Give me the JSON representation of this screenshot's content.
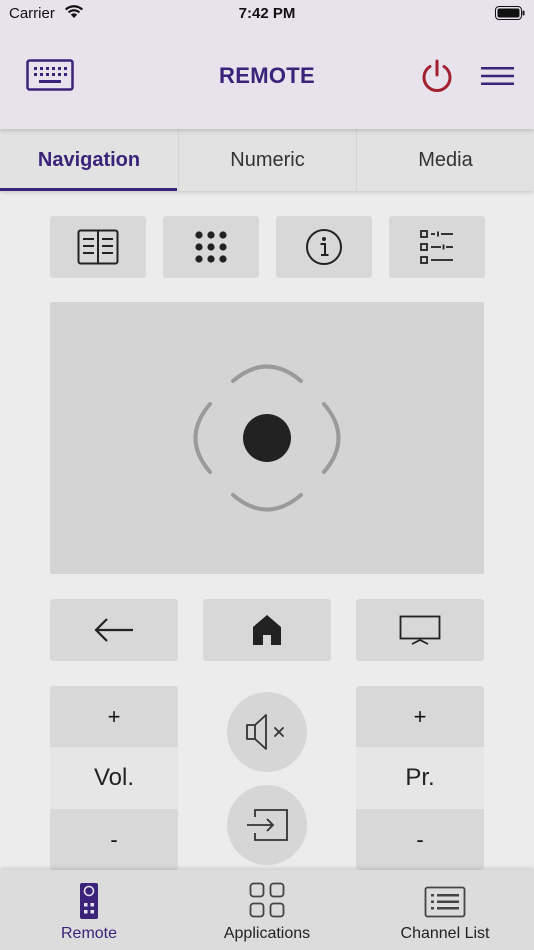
{
  "status_bar": {
    "carrier": "Carrier",
    "time": "7:42 PM"
  },
  "header": {
    "title": "REMOTE",
    "keyboard_icon": "keyboard-icon",
    "power_icon": "power-icon",
    "menu_icon": "hamburger-menu-icon"
  },
  "tabs": [
    {
      "label": "Navigation",
      "active": true
    },
    {
      "label": "Numeric",
      "active": false
    },
    {
      "label": "Media",
      "active": false
    }
  ],
  "function_buttons": [
    "guide-icon",
    "numpad-icon",
    "info-icon",
    "list-icon"
  ],
  "nav_buttons": [
    "back-arrow-icon",
    "home-icon",
    "tv-icon"
  ],
  "volume": {
    "plus": "+",
    "label": "Vol.",
    "minus": "-"
  },
  "program": {
    "plus": "+",
    "label": "Pr.",
    "minus": "-"
  },
  "center_buttons": [
    "mute-icon",
    "source-input-icon"
  ],
  "bottom_nav": [
    {
      "label": "Remote",
      "icon": "remote-icon",
      "active": true
    },
    {
      "label": "Applications",
      "icon": "apps-grid-icon",
      "active": false
    },
    {
      "label": "Channel List",
      "icon": "channel-list-icon",
      "active": false
    }
  ],
  "colors": {
    "accent": "#3b237a",
    "power": "#a3202e",
    "header_bg": "#e8e2ec",
    "page_bg": "#ececec"
  }
}
